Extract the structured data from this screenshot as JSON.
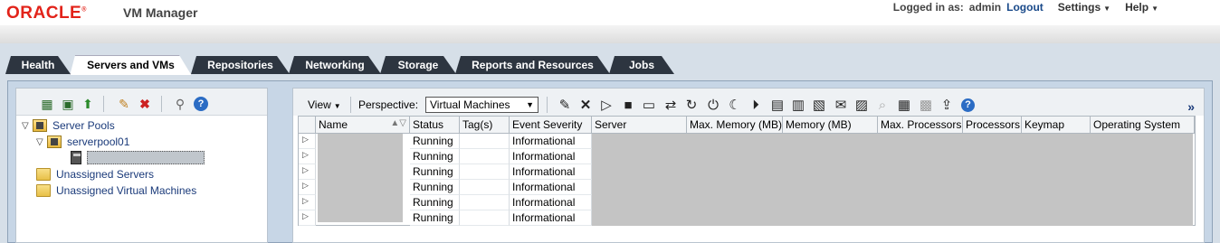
{
  "header": {
    "logo_text": "ORACLE",
    "logo_mark": "®",
    "app_name": "VM Manager",
    "logged_in_label": "Logged in as:",
    "username": "admin",
    "logout": "Logout",
    "settings": "Settings",
    "help": "Help"
  },
  "tabs": [
    {
      "label": "Health",
      "active": false
    },
    {
      "label": "Servers and VMs",
      "active": true
    },
    {
      "label": "Repositories",
      "active": false
    },
    {
      "label": "Networking",
      "active": false
    },
    {
      "label": "Storage",
      "active": false
    },
    {
      "label": "Reports and Resources",
      "active": false
    },
    {
      "label": "Jobs",
      "active": false
    }
  ],
  "left_toolbar_icons": [
    "create-server-pool-icon",
    "add-server-icon",
    "upload-icon",
    "edit-icon",
    "delete-icon",
    "search-icon",
    "help-icon"
  ],
  "tree": {
    "server_pools": "Server Pools",
    "pool_name": "serverpool01",
    "unassigned_servers": "Unassigned Servers",
    "unassigned_vms": "Unassigned Virtual Machines",
    "expand_glyph": "▽"
  },
  "right_toolbar": {
    "view": "View",
    "perspective_label": "Perspective:",
    "perspective_value": "Virtual Machines",
    "overflow": "»",
    "icons": [
      "edit-icon",
      "delete-icon",
      "start-icon",
      "stop-icon",
      "console-icon",
      "migrate-icon",
      "restart-icon",
      "kill-icon",
      "suspend-icon",
      "resume-icon",
      "clone-icon",
      "template-icon",
      "assembly-icon",
      "message-icon",
      "copy-icon",
      "sendmsg-icon",
      "export-icon",
      "upload-icon",
      "help-icon"
    ]
  },
  "table": {
    "columns": [
      "",
      "Name",
      "Status",
      "Tag(s)",
      "Event Severity",
      "Server",
      "Max. Memory (MB)",
      "Memory (MB)",
      "Max. Processors",
      "Processors",
      "Keymap",
      "Operating System"
    ],
    "rows": [
      {
        "status": "Running",
        "tags": "",
        "severity": "Informational"
      },
      {
        "status": "Running",
        "tags": "",
        "severity": "Informational"
      },
      {
        "status": "Running",
        "tags": "",
        "severity": "Informational"
      },
      {
        "status": "Running",
        "tags": "",
        "severity": "Informational"
      },
      {
        "status": "Running",
        "tags": "",
        "severity": "Informational"
      },
      {
        "status": "Running",
        "tags": "",
        "severity": "Informational"
      }
    ],
    "disclosure_glyph": "▷"
  }
}
